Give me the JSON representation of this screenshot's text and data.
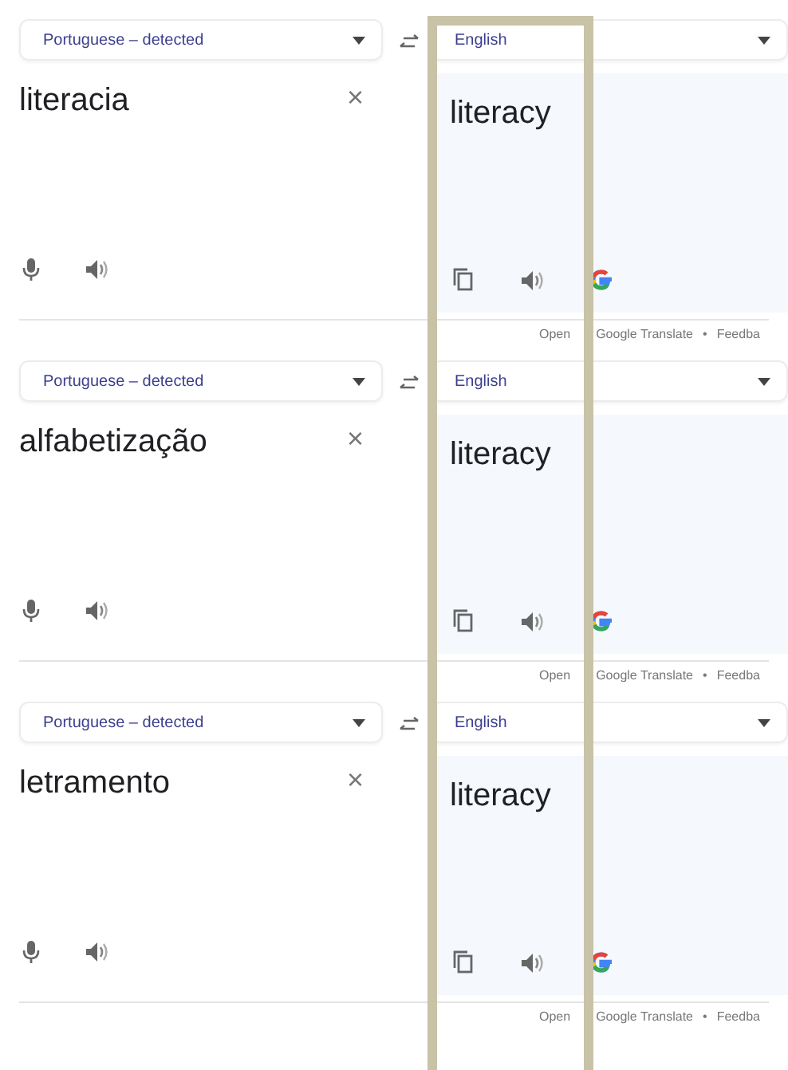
{
  "translations": [
    {
      "source_language": "Portuguese – detected",
      "target_language": "English",
      "source_text": "literacia",
      "clear": "×",
      "translation": "literacy",
      "footer": {
        "open": "Open",
        "link": "Google Translate",
        "separator": "•",
        "feedback": "Feedba"
      }
    },
    {
      "source_language": "Portuguese – detected",
      "target_language": "English",
      "source_text": "alfabetização",
      "clear": "×",
      "translation": "literacy",
      "footer": {
        "open": "Open",
        "link": "Google Translate",
        "separator": "•",
        "feedback": "Feedba"
      }
    },
    {
      "source_language": "Portuguese – detected",
      "target_language": "English",
      "source_text": "letramento",
      "clear": "×",
      "translation": "literacy",
      "footer": {
        "open": "Open",
        "link": "Google Translate",
        "separator": "•",
        "feedback": "Feedba"
      }
    }
  ]
}
